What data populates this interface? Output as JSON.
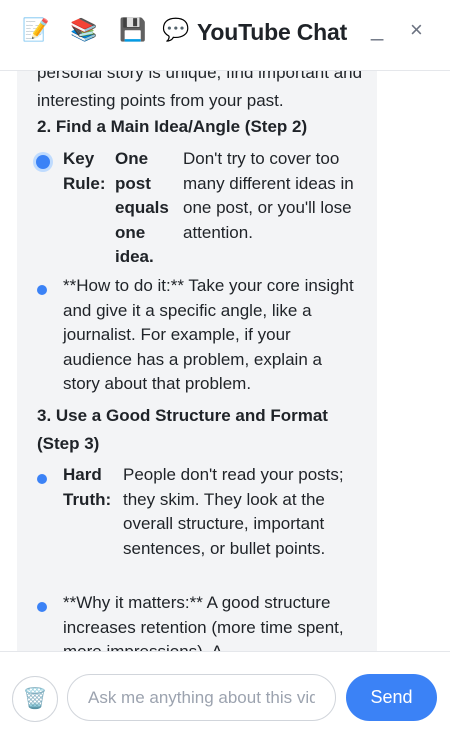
{
  "header": {
    "icons": [
      "memo-icon",
      "books-icon",
      "floppy-disk-icon",
      "speech-balloon-icon"
    ],
    "title": "YouTube Chat",
    "minimize_label": "_",
    "close_label": "×"
  },
  "message": {
    "intro": "personal story is unique, find important and interesting points from your past.",
    "step2_heading": "2. Find a Main Idea/Angle (Step 2)",
    "step2_table": {
      "col1": "Key Rule:",
      "col2": "One post equals one idea.",
      "col3": "Don't try to cover too many different ideas in one post, or you'll lose attention."
    },
    "step2_bullet": "**How to do it:** Take your core insight and give it a specific angle, like a journalist. For example, if your audience has a problem, explain a story about that problem.",
    "step3_heading": "3. Use a Good Structure and Format (Step 3)",
    "step3_table": {
      "col1": "Hard Truth:",
      "col2": "People don't read your posts; they skim. They look at the overall structure, important sentences, or bullet points."
    },
    "step3_bullet": "**Why it matters:** A good structure increases retention (more time spent, more impressions). A"
  },
  "footer": {
    "placeholder": "Ask me anything about this video...",
    "send_label": "Send"
  }
}
